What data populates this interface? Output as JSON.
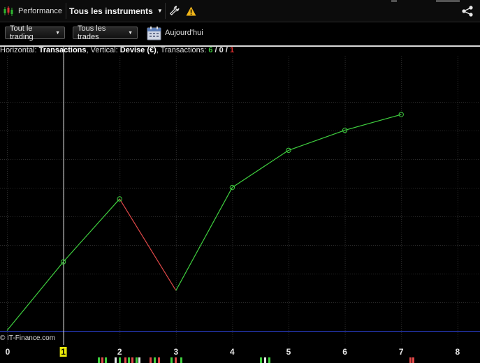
{
  "toolbar": {
    "performance_label": "Performance",
    "instruments_label": "Tous les instruments",
    "perf_icon": "candlestick-chart-icon",
    "wrench_icon": "wrench-icon",
    "warning_icon": "warning-icon",
    "share_icon": "share-icon"
  },
  "filters": {
    "trading_label": "Tout le trading",
    "trades_label": "Tous les trades",
    "calendar_icon": "calendar-icon",
    "date_label": "Aujourd'hui"
  },
  "info": {
    "horizontal_prefix": "Horizontal: ",
    "horizontal_value": "Transactions",
    "vertical_prefix": ", Vertical: ",
    "vertical_value": "Devise (€)",
    "transactions_prefix": ", Transactions: ",
    "wins": "6",
    "sep1": " / ",
    "neutral": "0",
    "sep2": " / ",
    "losses": "1"
  },
  "copyright": "© IT-Finance.com",
  "colors": {
    "up": "#3fcf3f",
    "down": "#e04848",
    "baseline": "#2a3fd0",
    "grid": "#2c2c2c",
    "cursor": "#e8e8e8",
    "highlight": "#e8e80a"
  },
  "chart_data": {
    "type": "line",
    "xlabel": "Transactions",
    "ylabel": "Devise (€)",
    "x": [
      0,
      1,
      2,
      3,
      4,
      5,
      6,
      7
    ],
    "y": [
      0,
      2.4,
      4.6,
      1.4,
      5.0,
      6.3,
      7.0,
      7.55
    ],
    "segment_colors": [
      "up",
      "up",
      "down",
      "up",
      "up",
      "up",
      "up"
    ],
    "xlim": [
      0,
      8.4
    ],
    "ylim": [
      -0.5,
      9.6
    ],
    "x_ticks": [
      "0",
      "1",
      "2",
      "3",
      "4",
      "5",
      "6",
      "7",
      "8"
    ],
    "highlighted_x": 1,
    "baseline_y": 0,
    "grid": true
  }
}
